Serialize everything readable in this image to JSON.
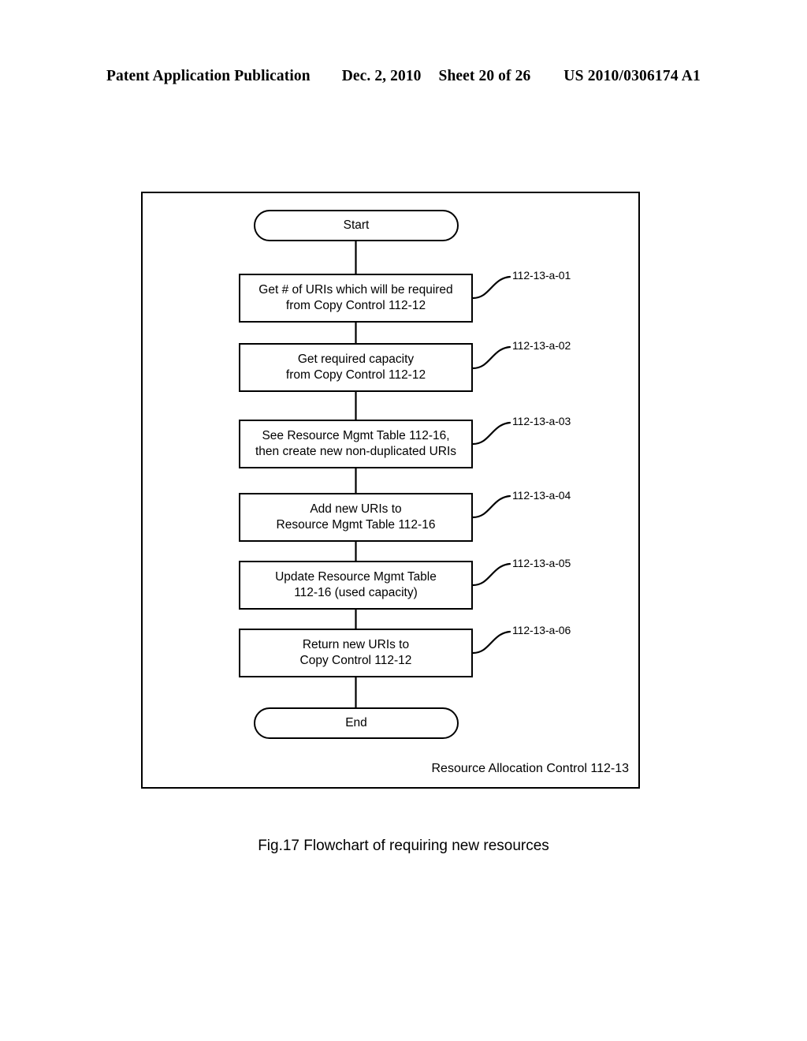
{
  "header": {
    "publication": "Patent Application Publication",
    "date": "Dec. 2, 2010",
    "sheet": "Sheet 20 of 26",
    "patent_number": "US 2010/0306174 A1"
  },
  "figure": {
    "caption": "Fig.17 Flowchart of requiring new resources",
    "container_label": "Resource Allocation Control 112-13",
    "border_color": "#000000",
    "background_color": "#ffffff"
  },
  "flowchart": {
    "start": {
      "label": "Start",
      "shape": "terminator"
    },
    "end": {
      "label": "End",
      "shape": "terminator"
    },
    "steps": [
      {
        "id": "112-13-a-01",
        "label": "Get # of URIs which will be required\nfrom Copy Control 112-12",
        "shape": "process"
      },
      {
        "id": "112-13-a-02",
        "label": "Get required capacity\nfrom Copy Control 112-12",
        "shape": "process"
      },
      {
        "id": "112-13-a-03",
        "label": "See Resource Mgmt Table 112-16,\nthen create new non-duplicated URIs",
        "shape": "process"
      },
      {
        "id": "112-13-a-04",
        "label": "Add new URIs to\nResource Mgmt Table 112-16",
        "shape": "process"
      },
      {
        "id": "112-13-a-05",
        "label": "Update Resource Mgmt Table\n112-16 (used capacity)",
        "shape": "process"
      },
      {
        "id": "112-13-a-06",
        "label": "Return new URIs to\nCopy Control 112-12",
        "shape": "process"
      }
    ]
  }
}
